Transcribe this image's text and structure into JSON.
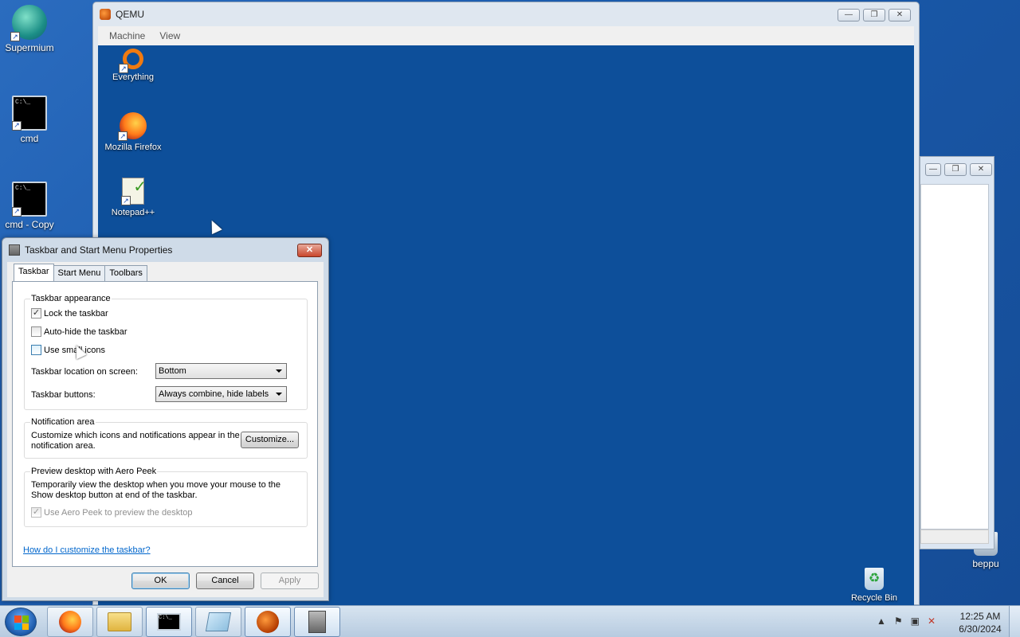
{
  "host_desktop": {
    "icons": [
      {
        "label": "Supermium"
      },
      {
        "label": "cmd"
      },
      {
        "label": "cmd - Copy"
      },
      {
        "label": "beppu"
      }
    ]
  },
  "qemu": {
    "title": "QEMU",
    "menu": [
      "Machine",
      "View"
    ],
    "guest_icons": [
      {
        "label": "Everything"
      },
      {
        "label": "Mozilla Firefox"
      },
      {
        "label": "Notepad++"
      },
      {
        "label": "Recycle Bin"
      }
    ]
  },
  "dialog": {
    "title": "Taskbar and Start Menu Properties",
    "tabs": [
      "Taskbar",
      "Start Menu",
      "Toolbars"
    ],
    "appearance": {
      "heading": "Taskbar appearance",
      "lock_label": "Lock the taskbar",
      "lock_checked": true,
      "autohide_label": "Auto-hide the taskbar",
      "small_icons_label": "Use small icons",
      "location_label": "Taskbar location on screen:",
      "location_value": "Bottom",
      "buttons_label": "Taskbar buttons:",
      "buttons_value": "Always combine, hide labels"
    },
    "notification": {
      "heading": "Notification area",
      "text": "Customize which icons and notifications appear in the notification area.",
      "button": "Customize..."
    },
    "aero": {
      "heading": "Preview desktop with Aero Peek",
      "text": "Temporarily view the desktop when you move your mouse to the Show desktop button at end of the taskbar.",
      "checkbox": "Use Aero Peek to preview the desktop"
    },
    "help_link": "How do I customize the taskbar?",
    "ok": "OK",
    "cancel": "Cancel",
    "apply": "Apply"
  },
  "taskbar": {
    "clock_time": "12:25 AM",
    "clock_date": "6/30/2024"
  },
  "check_mark": "✓"
}
